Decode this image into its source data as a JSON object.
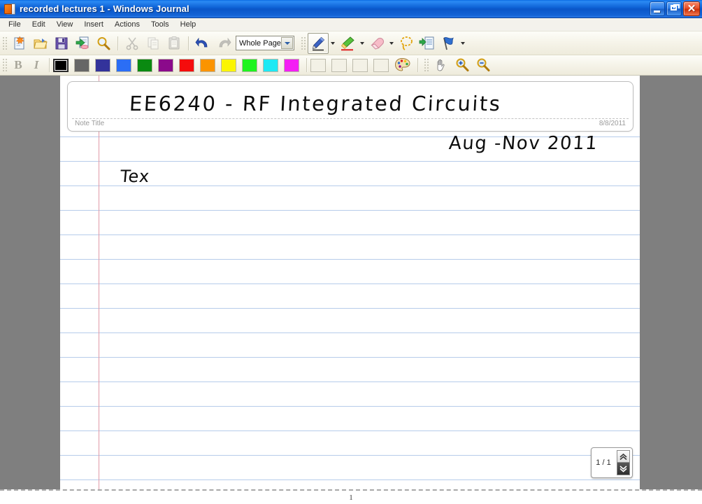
{
  "window": {
    "title": "recorded lectures 1 - Windows Journal",
    "app_icon": "journal-icon",
    "controls": {
      "minimize": "Minimize",
      "restore": "Restore",
      "close": "Close",
      "close_glyph": "✕"
    }
  },
  "menubar": {
    "items": [
      {
        "label": "File"
      },
      {
        "label": "Edit"
      },
      {
        "label": "View"
      },
      {
        "label": "Insert"
      },
      {
        "label": "Actions"
      },
      {
        "label": "Tools"
      },
      {
        "label": "Help"
      }
    ]
  },
  "toolbar_main": {
    "buttons": [
      {
        "name": "new-note-button",
        "icon": "new-document-icon",
        "label": "New Note",
        "enabled": true
      },
      {
        "name": "open-button",
        "icon": "open-folder-icon",
        "label": "Open",
        "enabled": true
      },
      {
        "name": "save-button",
        "icon": "floppy-disk-icon",
        "label": "Save",
        "enabled": true
      },
      {
        "name": "export-button",
        "icon": "export-document-icon",
        "label": "Export As",
        "enabled": true
      },
      {
        "name": "search-button",
        "icon": "magnifier-icon",
        "label": "Find",
        "enabled": true
      },
      {
        "name": "cut-button",
        "icon": "scissors-icon",
        "label": "Cut",
        "enabled": false
      },
      {
        "name": "copy-button",
        "icon": "copy-pages-icon",
        "label": "Copy",
        "enabled": false
      },
      {
        "name": "paste-button",
        "icon": "clipboard-icon",
        "label": "Paste",
        "enabled": false
      },
      {
        "name": "undo-button",
        "icon": "undo-arrow-icon",
        "label": "Undo",
        "enabled": true
      },
      {
        "name": "redo-button",
        "icon": "redo-arrow-icon",
        "label": "Redo",
        "enabled": false
      }
    ],
    "zoom": {
      "value": "Whole Page",
      "label": "Zoom level"
    },
    "tools": [
      {
        "name": "pen-tool-button",
        "icon": "blue-pen-icon",
        "label": "Pen",
        "selected": true,
        "has_dropdown": true
      },
      {
        "name": "highlighter-tool-button",
        "icon": "green-highlighter-icon",
        "label": "Highlighter",
        "selected": false,
        "has_dropdown": true
      },
      {
        "name": "eraser-tool-button",
        "icon": "pink-eraser-icon",
        "label": "Eraser",
        "selected": false,
        "has_dropdown": true
      },
      {
        "name": "selection-tool-button",
        "icon": "lasso-selection-icon",
        "label": "Selection Tool",
        "selected": false,
        "has_dropdown": false
      },
      {
        "name": "insert-space-button",
        "icon": "insert-space-icon",
        "label": "Insert/Remove Space",
        "selected": false,
        "has_dropdown": false
      },
      {
        "name": "flag-note-button",
        "icon": "blue-flag-icon",
        "label": "Flag Note",
        "selected": false,
        "has_dropdown": true
      }
    ]
  },
  "toolbar_format": {
    "bold": {
      "label": "B",
      "name": "bold-button",
      "enabled": false
    },
    "italic": {
      "label": "I",
      "name": "italic-button",
      "enabled": false
    },
    "colors": [
      {
        "name": "color-black",
        "hex": "#000000",
        "selected": true
      },
      {
        "name": "color-gray",
        "hex": "#666666",
        "selected": false
      },
      {
        "name": "color-indigo",
        "hex": "#33339b",
        "selected": false
      },
      {
        "name": "color-blue",
        "hex": "#2b6ef5",
        "selected": false
      },
      {
        "name": "color-green",
        "hex": "#0a8a11",
        "selected": false
      },
      {
        "name": "color-purple",
        "hex": "#8b0a8b",
        "selected": false
      },
      {
        "name": "color-red",
        "hex": "#f50c0c",
        "selected": false
      },
      {
        "name": "color-orange",
        "hex": "#fb9400",
        "selected": false
      },
      {
        "name": "color-yellow",
        "hex": "#fbf500",
        "selected": false
      },
      {
        "name": "color-bright-green",
        "hex": "#1ef41e",
        "selected": false
      },
      {
        "name": "color-cyan",
        "hex": "#1ee9f4",
        "selected": false
      },
      {
        "name": "color-magenta",
        "hex": "#f41ef4",
        "selected": false
      }
    ],
    "custom_slots": [
      {
        "name": "custom-color-slot-1"
      },
      {
        "name": "custom-color-slot-2"
      },
      {
        "name": "custom-color-slot-3"
      },
      {
        "name": "custom-color-slot-4"
      }
    ],
    "palette_button": {
      "name": "color-palette-button",
      "icon": "palette-icon",
      "label": "More Colors"
    },
    "view_tools": [
      {
        "name": "pan-button",
        "icon": "hand-pan-icon",
        "label": "Pan"
      },
      {
        "name": "zoom-in-button",
        "icon": "magnifier-plus-icon",
        "label": "Zoom In"
      },
      {
        "name": "zoom-out-button",
        "icon": "magnifier-minus-icon",
        "label": "Zoom Out"
      }
    ]
  },
  "note": {
    "title_ink": "EE6240 - RF Integrated Circuits",
    "title_placeholder": "Note Title",
    "date": "8/8/2011",
    "body_ink": [
      {
        "text": "Aug -Nov 2011",
        "name": "ink-date-range"
      },
      {
        "text": "Tex",
        "name": "ink-text-partial"
      }
    ]
  },
  "page_nav": {
    "indicator": "1 / 1",
    "previous_label": "Previous Page",
    "next_label": "Next Page"
  },
  "status": {
    "page_number": "1"
  }
}
